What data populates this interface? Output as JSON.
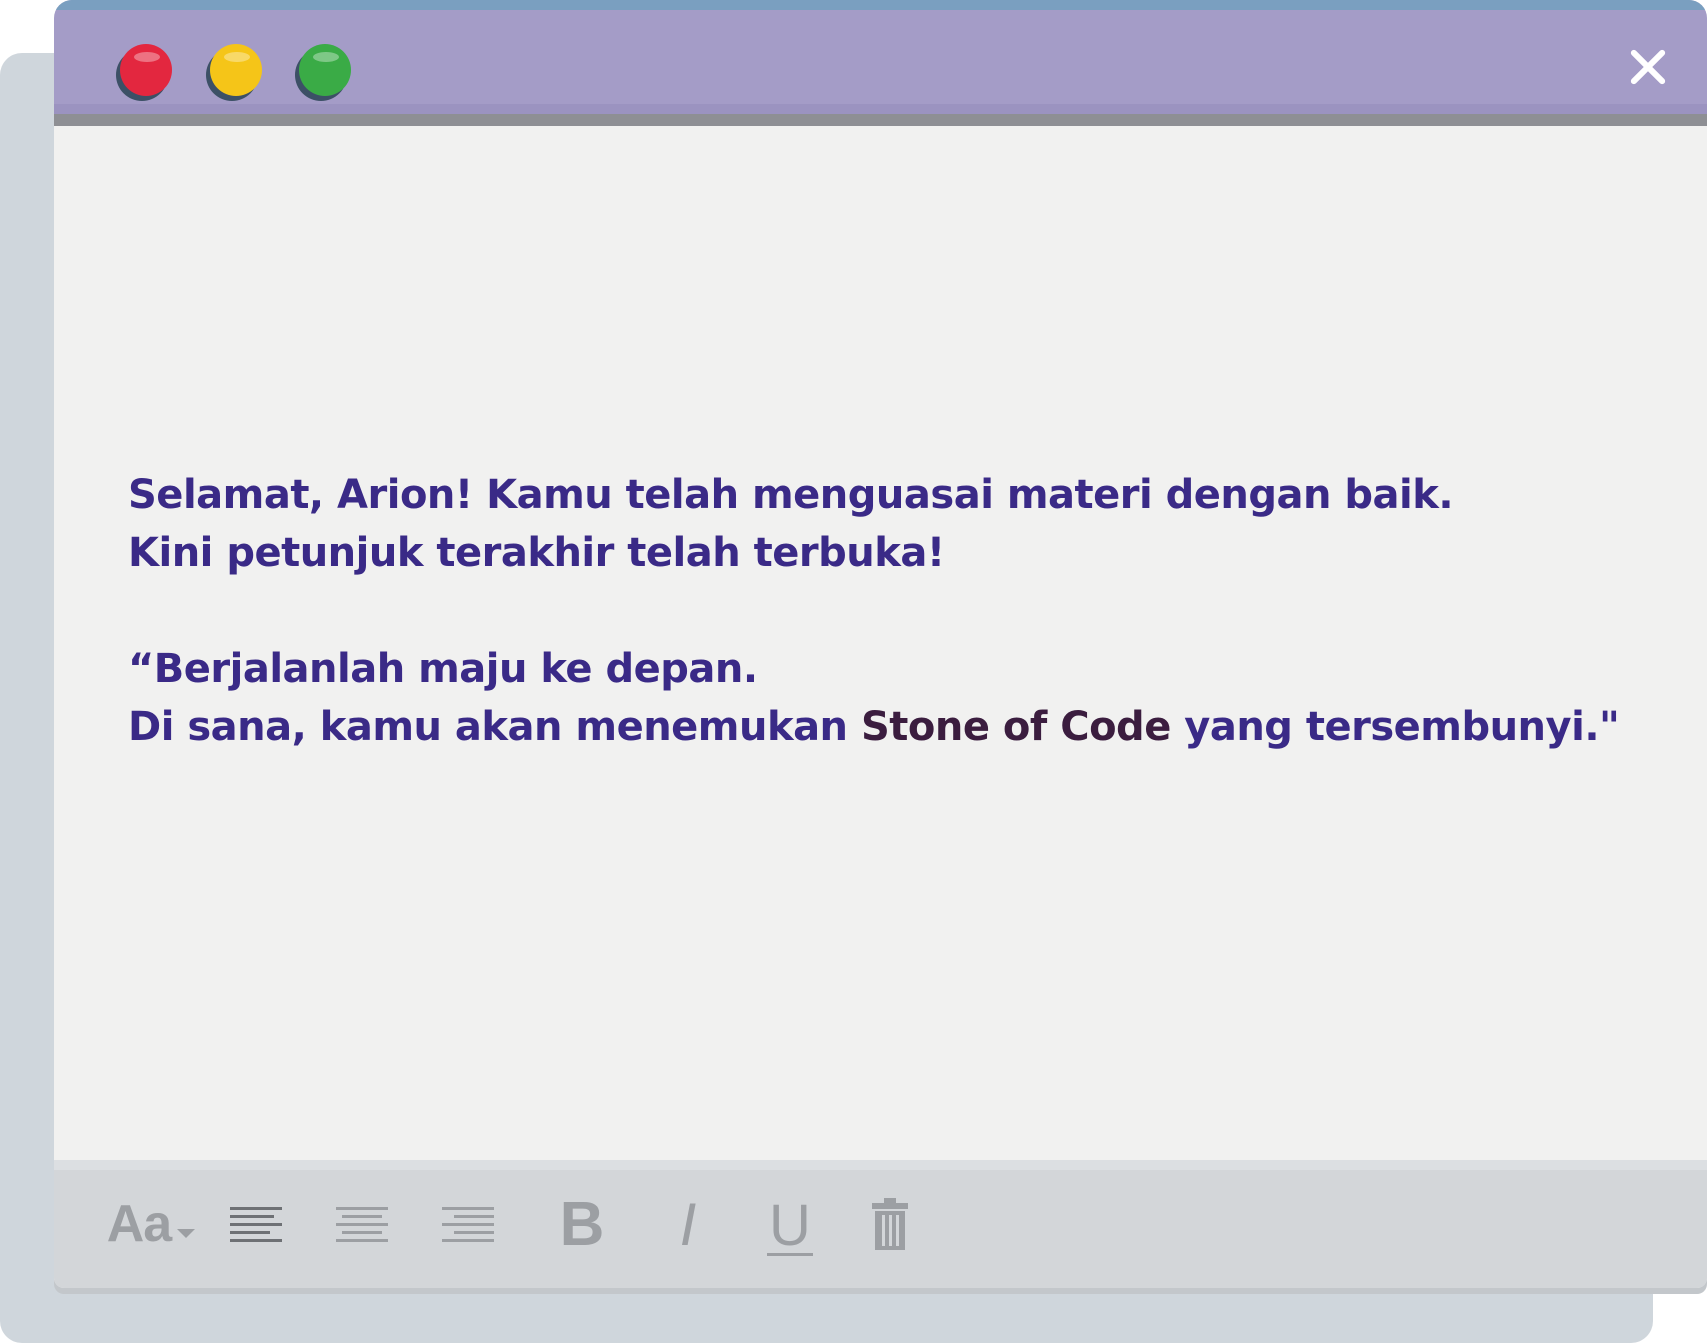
{
  "window": {
    "close_label": "×"
  },
  "message": {
    "line1": "Selamat, Arion! Kamu telah menguasai materi dengan baik.",
    "line2": "Kini petunjuk terakhir telah terbuka!",
    "line3": "“Berjalanlah maju ke depan.",
    "line4_before": "Di sana, kamu akan menemukan ",
    "line4_highlight": "Stone of Code",
    "line4_after": " yang tersembunyi.\""
  },
  "toolbar": {
    "font_label": "Aa",
    "bold_label": "B",
    "italic_label": "I",
    "underline_label": "U"
  },
  "colors": {
    "title_bar": "#a49cc7",
    "title_bar_top": "#7a9fc0",
    "text": "#3a2a87",
    "highlight_text": "#3b1d3f",
    "toolbar": "#d3d6d9",
    "traffic_red": "#e3273f",
    "traffic_yellow": "#f5c518",
    "traffic_green": "#3aab46"
  },
  "icons": [
    "close-icon",
    "align-left-icon",
    "align-center-icon",
    "align-right-icon",
    "trash-icon"
  ]
}
